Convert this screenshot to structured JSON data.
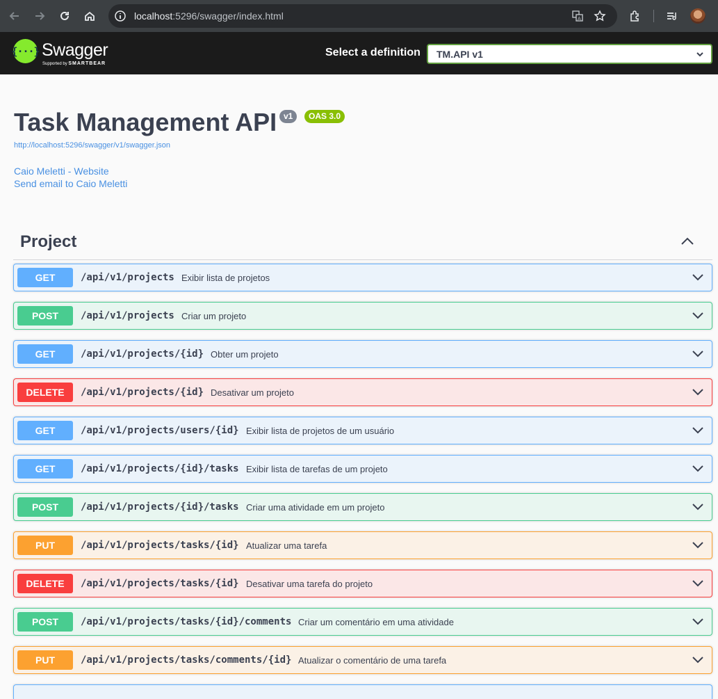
{
  "browser": {
    "url_host": "localhost",
    "url_rest": ":5296/swagger/index.html"
  },
  "topbar": {
    "logo_symbol": "{···}",
    "logo_text": "Swagger",
    "logo_supported": "Supported by",
    "logo_brand": "SMARTBEAR",
    "select_label": "Select a definition",
    "selected_definition": "TM.API v1"
  },
  "info": {
    "title": "Task Management API",
    "version_badge": "v1",
    "oas_badge": "OAS 3.0",
    "spec_url": "http://localhost:5296/swagger/v1/swagger.json",
    "contact_website": "Caio Meletti - Website",
    "contact_email": "Send email to Caio Meletti"
  },
  "tag": {
    "name": "Project",
    "expanded": true
  },
  "colors": {
    "get": "#61affe",
    "post": "#49cc90",
    "delete": "#f93e3e",
    "put": "#fca130"
  },
  "operations": [
    {
      "method": "GET",
      "path": "/api/v1/projects",
      "summary": "Exibir lista de projetos"
    },
    {
      "method": "POST",
      "path": "/api/v1/projects",
      "summary": "Criar um projeto"
    },
    {
      "method": "GET",
      "path": "/api/v1/projects/{id}",
      "summary": "Obter um projeto"
    },
    {
      "method": "DELETE",
      "path": "/api/v1/projects/{id}",
      "summary": "Desativar um projeto"
    },
    {
      "method": "GET",
      "path": "/api/v1/projects/users/{id}",
      "summary": "Exibir lista de projetos de um usuário"
    },
    {
      "method": "GET",
      "path": "/api/v1/projects/{id}/tasks",
      "summary": "Exibir lista de tarefas de um projeto"
    },
    {
      "method": "POST",
      "path": "/api/v1/projects/{id}/tasks",
      "summary": "Criar uma atividade em um projeto"
    },
    {
      "method": "PUT",
      "path": "/api/v1/projects/tasks/{id}",
      "summary": "Atualizar uma tarefa"
    },
    {
      "method": "DELETE",
      "path": "/api/v1/projects/tasks/{id}",
      "summary": "Desativar uma tarefa do projeto"
    },
    {
      "method": "POST",
      "path": "/api/v1/projects/tasks/{id}/comments",
      "summary": "Criar um comentário em uma atividade"
    },
    {
      "method": "PUT",
      "path": "/api/v1/projects/tasks/comments/{id}",
      "summary": "Atualizar o comentário de uma tarefa"
    }
  ]
}
